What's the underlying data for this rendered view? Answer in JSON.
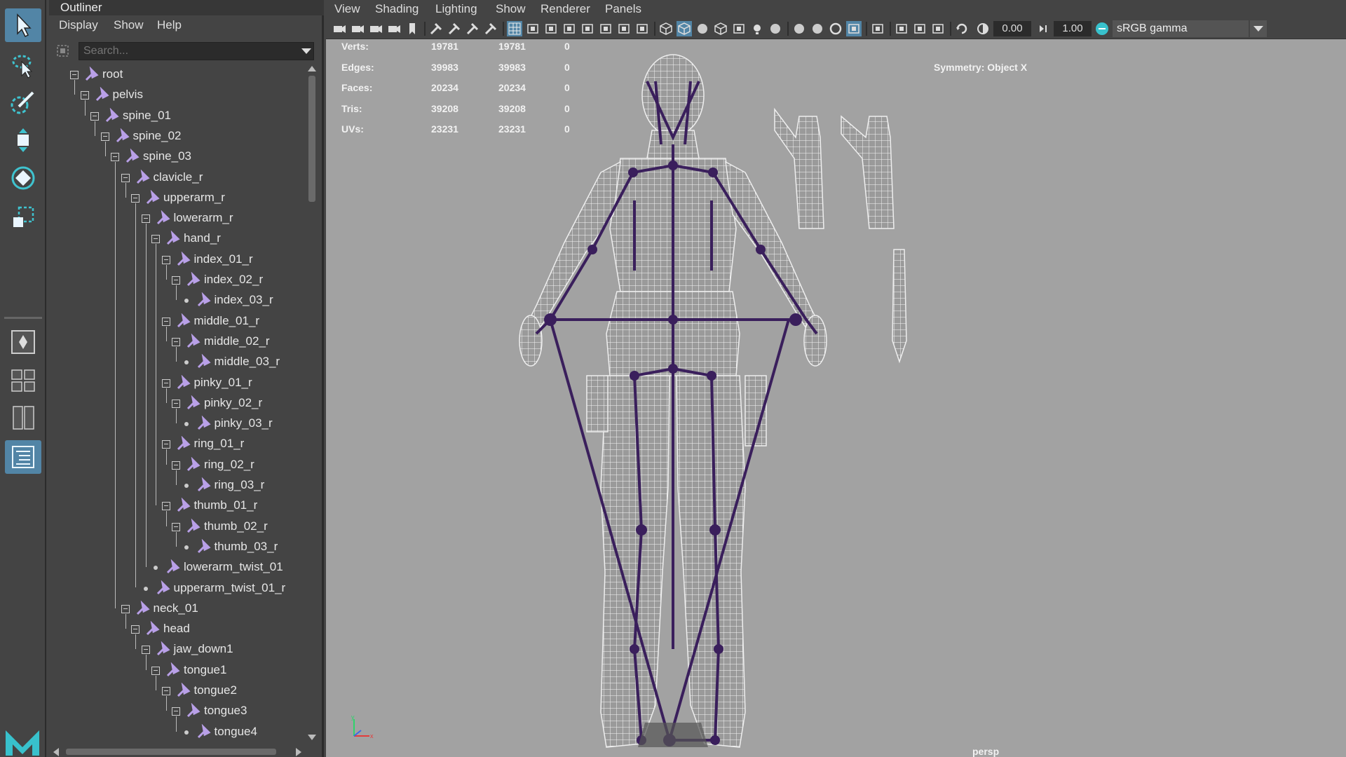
{
  "app": {
    "name": "Maya"
  },
  "outliner": {
    "title": "Outliner",
    "menu": [
      "Display",
      "Show",
      "Help"
    ],
    "search_placeholder": "Search...",
    "nodes": [
      {
        "label": "root",
        "depth": 0,
        "type": "box"
      },
      {
        "label": "pelvis",
        "depth": 1,
        "type": "box"
      },
      {
        "label": "spine_01",
        "depth": 2,
        "type": "box"
      },
      {
        "label": "spine_02",
        "depth": 3,
        "type": "box"
      },
      {
        "label": "spine_03",
        "depth": 4,
        "type": "box"
      },
      {
        "label": "clavicle_r",
        "depth": 5,
        "type": "box"
      },
      {
        "label": "upperarm_r",
        "depth": 6,
        "type": "box"
      },
      {
        "label": "lowerarm_r",
        "depth": 7,
        "type": "box"
      },
      {
        "label": "hand_r",
        "depth": 8,
        "type": "box"
      },
      {
        "label": "index_01_r",
        "depth": 9,
        "type": "box"
      },
      {
        "label": "index_02_r",
        "depth": 10,
        "type": "box"
      },
      {
        "label": "index_03_r",
        "depth": 11,
        "type": "dot"
      },
      {
        "label": "middle_01_r",
        "depth": 9,
        "type": "box"
      },
      {
        "label": "middle_02_r",
        "depth": 10,
        "type": "box"
      },
      {
        "label": "middle_03_r",
        "depth": 11,
        "type": "dot"
      },
      {
        "label": "pinky_01_r",
        "depth": 9,
        "type": "box"
      },
      {
        "label": "pinky_02_r",
        "depth": 10,
        "type": "box"
      },
      {
        "label": "pinky_03_r",
        "depth": 11,
        "type": "dot"
      },
      {
        "label": "ring_01_r",
        "depth": 9,
        "type": "box"
      },
      {
        "label": "ring_02_r",
        "depth": 10,
        "type": "box"
      },
      {
        "label": "ring_03_r",
        "depth": 11,
        "type": "dot"
      },
      {
        "label": "thumb_01_r",
        "depth": 9,
        "type": "box"
      },
      {
        "label": "thumb_02_r",
        "depth": 10,
        "type": "box"
      },
      {
        "label": "thumb_03_r",
        "depth": 11,
        "type": "dot"
      },
      {
        "label": "lowerarm_twist_01",
        "depth": 8,
        "type": "dot"
      },
      {
        "label": "upperarm_twist_01_r",
        "depth": 7,
        "type": "dot"
      },
      {
        "label": "neck_01",
        "depth": 5,
        "type": "box"
      },
      {
        "label": "head",
        "depth": 6,
        "type": "box"
      },
      {
        "label": "jaw_down1",
        "depth": 7,
        "type": "box"
      },
      {
        "label": "tongue1",
        "depth": 8,
        "type": "box"
      },
      {
        "label": "tongue2",
        "depth": 9,
        "type": "box"
      },
      {
        "label": "tongue3",
        "depth": 10,
        "type": "box"
      },
      {
        "label": "tongue4",
        "depth": 11,
        "type": "dot"
      }
    ]
  },
  "viewport": {
    "menu": [
      "View",
      "Shading",
      "Lighting",
      "Show",
      "Renderer",
      "Panels"
    ],
    "exposure": "0.00",
    "gamma": "1.00",
    "color_space": "sRGB gamma",
    "hud": [
      {
        "label": "Verts:",
        "a": "19781",
        "b": "19781",
        "c": "0"
      },
      {
        "label": "Edges:",
        "a": "39983",
        "b": "39983",
        "c": "0"
      },
      {
        "label": "Faces:",
        "a": "20234",
        "b": "20234",
        "c": "0"
      },
      {
        "label": "Tris:",
        "a": "39208",
        "b": "39208",
        "c": "0"
      },
      {
        "label": "UVs:",
        "a": "23231",
        "b": "23231",
        "c": "0"
      }
    ],
    "symmetry": "Symmetry: Object X",
    "camera": "persp"
  },
  "colors": {
    "accent": "#5285a6",
    "joint": "#3a1f5c",
    "joint_icon": "#b9a0e8",
    "viewport_bg": "#a2a2a2",
    "panel_bg": "#444444"
  }
}
